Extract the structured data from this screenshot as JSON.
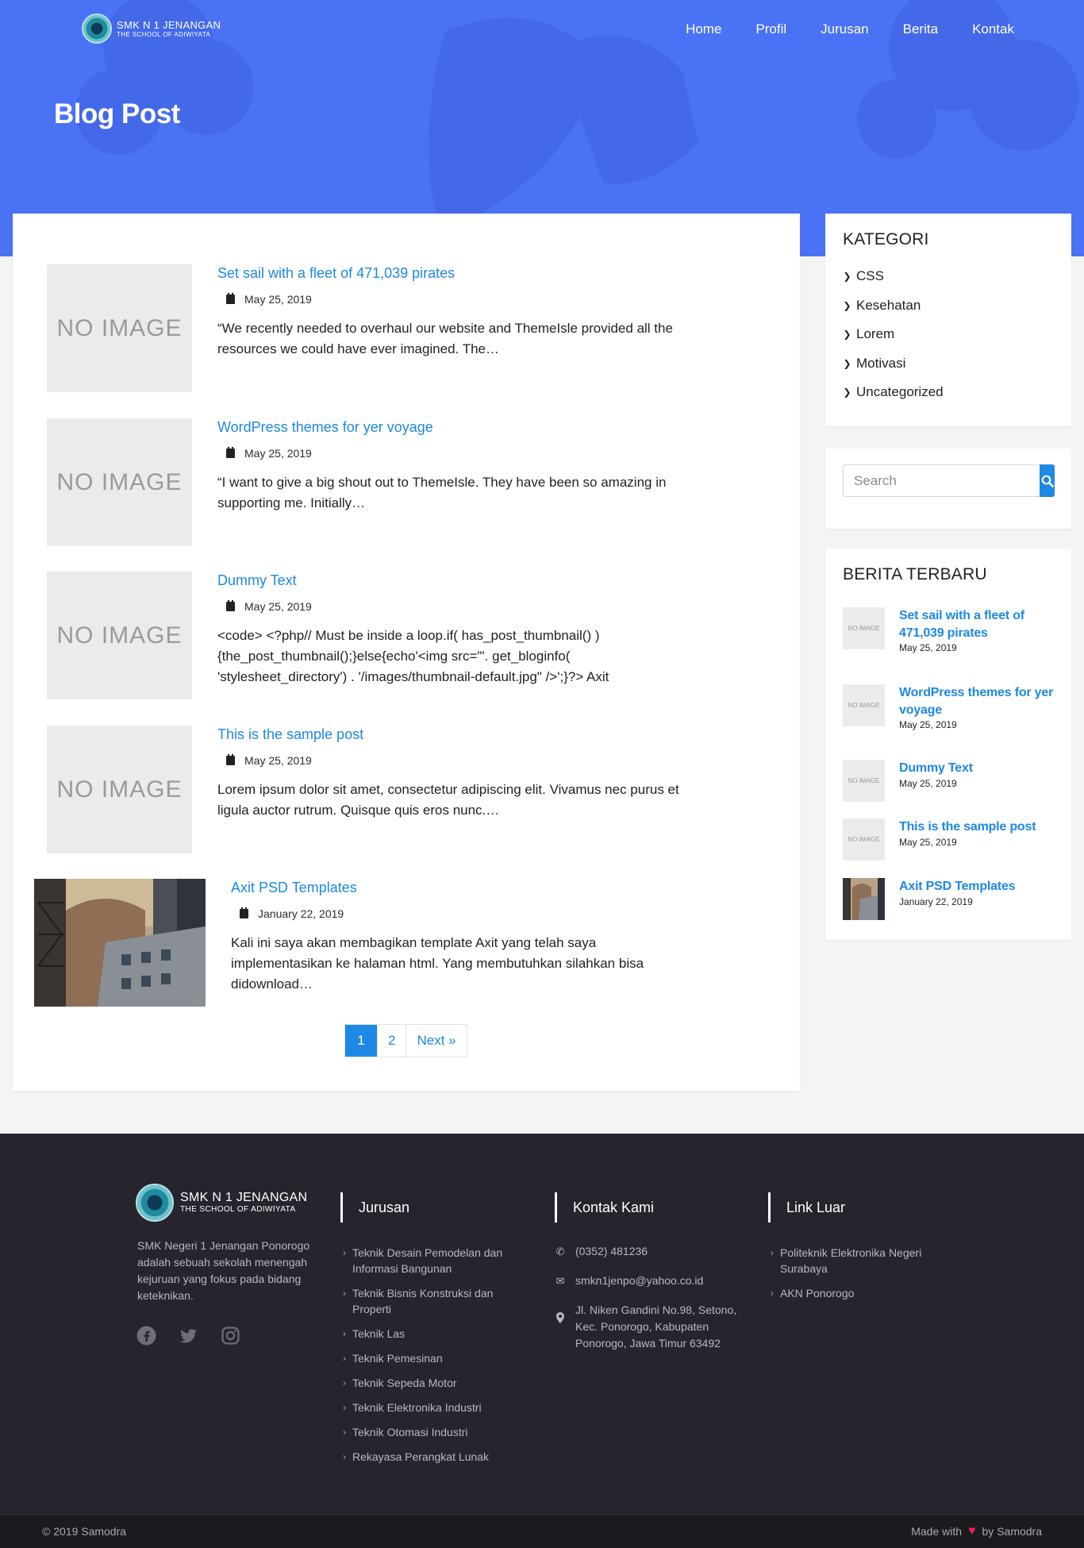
{
  "header": {
    "logo": {
      "title": "SMK N 1 JENANGAN",
      "subtitle": "THE SCHOOL OF ADIWIYATA"
    },
    "nav": [
      "Home",
      "Profil",
      "Jurusan",
      "Berita",
      "Kontak"
    ],
    "page_title": "Blog Post"
  },
  "posts": [
    {
      "title": "Set sail with a fleet of 471,039 pirates",
      "date": "May 25, 2019",
      "excerpt": "“We recently needed to overhaul our website and ThemeIsle provided all the resources we could have ever imagined. The…",
      "thumbnail": "NO IMAGE"
    },
    {
      "title": "WordPress themes for yer voyage",
      "date": "May 25, 2019",
      "excerpt": "“I want to give a big shout out to ThemeIsle. They have been so amazing in supporting me. Initially…",
      "thumbnail": "NO IMAGE"
    },
    {
      "title": "Dummy Text",
      "date": "May 25, 2019",
      "excerpt": "<code> <?php// Must be inside a loop.if( has_post_thumbnail() ) {the_post_thumbnail();}else{echo'<img src=\"'. get_bloginfo( 'stylesheet_directory') . '/images/thumbnail-default.jpg\" />';}?> Axit",
      "thumbnail": "NO IMAGE"
    },
    {
      "title": "This is the sample post",
      "date": "May 25, 2019",
      "excerpt": "Lorem ipsum dolor sit amet, consectetur adipiscing elit. Vivamus nec purus et ligula auctor rutrum. Quisque quis eros nunc.…",
      "thumbnail": "NO IMAGE"
    },
    {
      "title": "Axit PSD Templates",
      "date": "January 22, 2019",
      "excerpt": "Kali ini saya akan membagikan template Axit yang telah saya implementasikan ke halaman html. Yang membutuhkan silahkan bisa didownload…",
      "thumbnail": "photo"
    }
  ],
  "pagination": {
    "pages": [
      "1",
      "2"
    ],
    "active": "1",
    "next": "Next »"
  },
  "sidebar": {
    "kategori": {
      "title": "KATEGORI",
      "items": [
        "CSS",
        "Kesehatan",
        "Lorem",
        "Motivasi",
        "Uncategorized"
      ]
    },
    "search": {
      "placeholder": "Search"
    },
    "berita": {
      "title": "BERITA TERBARU",
      "items": [
        {
          "title": "Set sail with a fleet of 471,039 pirates",
          "date": "May 25, 2019",
          "thumbnail": "NO IMAGE"
        },
        {
          "title": "WordPress themes for yer voyage",
          "date": "May 25, 2019",
          "thumbnail": "NO IMAGE"
        },
        {
          "title": "Dummy Text",
          "date": "May 25, 2019",
          "thumbnail": "NO IMAGE"
        },
        {
          "title": "This is the sample post",
          "date": "May 25, 2019",
          "thumbnail": "NO IMAGE"
        },
        {
          "title": "Axit PSD Templates",
          "date": "January 22, 2019",
          "thumbnail": "photo"
        }
      ]
    }
  },
  "footer": {
    "logo": {
      "title": "SMK N 1 JENANGAN",
      "subtitle": "THE SCHOOL OF ADIWIYATA"
    },
    "about": "SMK Negeri 1 Jenangan Ponorogo adalah sebuah sekolah menengah kejuruan yang fokus pada bidang keteknikan.",
    "socials": [
      "facebook-icon",
      "twitter-icon",
      "instagram-icon"
    ],
    "jurusan": {
      "title": "Jurusan",
      "items": [
        "Teknik Desain Pemodelan dan Informasi Bangunan",
        "Teknik Bisnis Konstruksi dan Properti",
        "Teknik Las",
        "Teknik Pemesinan",
        "Teknik Sepeda Motor",
        "Teknik Elektronika Industri",
        "Teknik Otomasi Industri",
        "Rekayasa Perangkat Lunak"
      ]
    },
    "kontak": {
      "title": "Kontak Kami",
      "phone": "(0352) 481236",
      "email": "smkn1jenpo@yahoo.co.id",
      "address": "Jl. Niken Gandini No.98, Setono, Kec. Ponorogo, Kabupaten Ponorogo, Jawa Timur 63492"
    },
    "link_luar": {
      "title": "Link Luar",
      "items": [
        "Politeknik Elektronika Negeri Surabaya",
        "AKN Ponorogo"
      ]
    },
    "copyright": "© 2019 Samodra",
    "made_with": "Made with",
    "by": "by Samodra"
  },
  "colors": {
    "hero": "#4a72f5",
    "accent": "#1e88e5",
    "footer": "#26252e",
    "heart": "#e8245a"
  }
}
